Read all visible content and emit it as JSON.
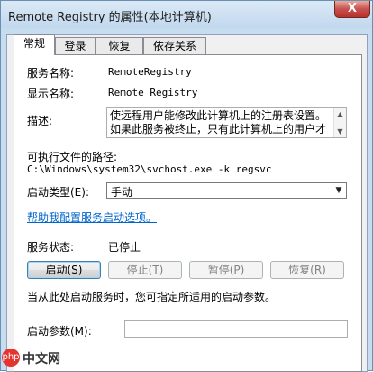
{
  "window": {
    "title": "Remote Registry 的属性(本地计算机)",
    "close_label": "X"
  },
  "tabs": [
    {
      "label": "常规",
      "active": true
    },
    {
      "label": "登录",
      "active": false
    },
    {
      "label": "恢复",
      "active": false
    },
    {
      "label": "依存关系",
      "active": false
    }
  ],
  "general": {
    "service_name_label": "服务名称:",
    "service_name_value": "RemoteRegistry",
    "display_name_label": "显示名称:",
    "display_name_value": "Remote Registry",
    "description_label": "描述:",
    "description_value": "使远程用户能修改此计算机上的注册表设置。如果此服务被终止，只有此计算机上的用户才",
    "exec_path_label": "可执行文件的路径:",
    "exec_path_value": "C:\\Windows\\system32\\svchost.exe -k regsvc",
    "startup_type_label": "启动类型(E):",
    "startup_type_value": "手动",
    "help_link": "帮助我配置服务启动选项。",
    "status_label": "服务状态:",
    "status_value": "已停止",
    "start_button": "启动(S)",
    "stop_button": "停止(T)",
    "pause_button": "暂停(P)",
    "resume_button": "恢复(R)",
    "start_hint": "当从此处启动服务时，您可指定所适用的启动参数。",
    "start_params_label": "启动参数(M):",
    "start_params_value": ""
  },
  "watermark": {
    "logo_text": "php",
    "site_text": "中文网"
  }
}
